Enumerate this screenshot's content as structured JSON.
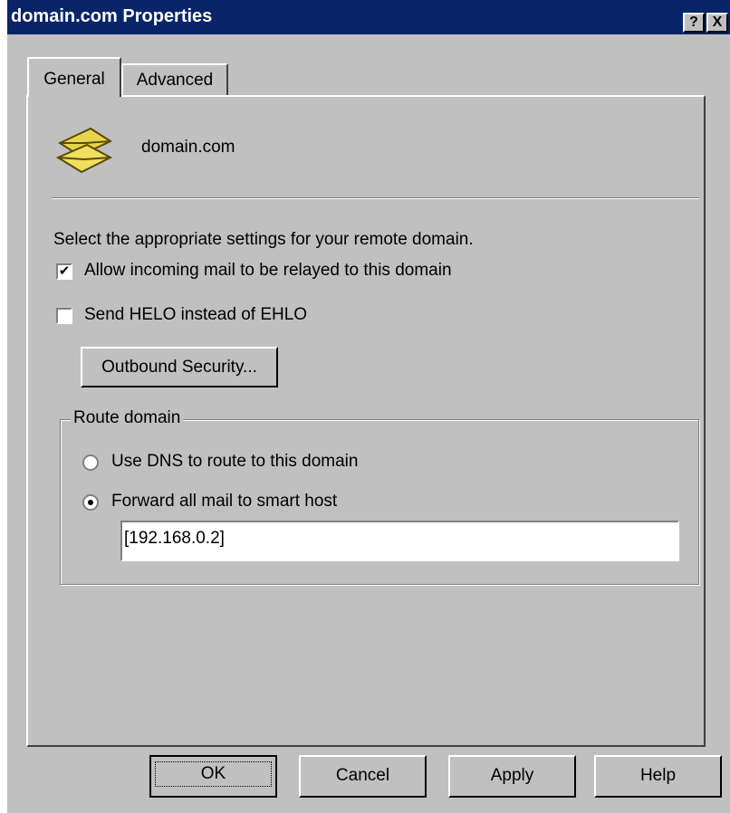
{
  "window": {
    "title": "domain.com Properties",
    "help_glyph": "?",
    "close_glyph": "X"
  },
  "tabs": [
    {
      "label": "General",
      "active": true
    },
    {
      "label": "Advanced",
      "active": false
    }
  ],
  "header": {
    "icon": "envelopes-icon",
    "domain_name": "domain.com"
  },
  "settings": {
    "instruction": "Select the appropriate settings for your remote domain.",
    "allow_relay": {
      "label": "Allow incoming mail to be relayed to this domain",
      "checked": true
    },
    "send_helo": {
      "label": "Send HELO instead of EHLO",
      "checked": false
    },
    "outbound_security_label": "Outbound Security..."
  },
  "route": {
    "legend": "Route domain",
    "use_dns": {
      "label": "Use DNS to route to this domain",
      "selected": false
    },
    "forward": {
      "label": "Forward all mail to smart host",
      "selected": true
    },
    "smart_host_value": "[192.168.0.2]"
  },
  "footer": {
    "ok": "OK",
    "cancel": "Cancel",
    "apply": "Apply",
    "help": "Help"
  },
  "check_glyph": "✔"
}
